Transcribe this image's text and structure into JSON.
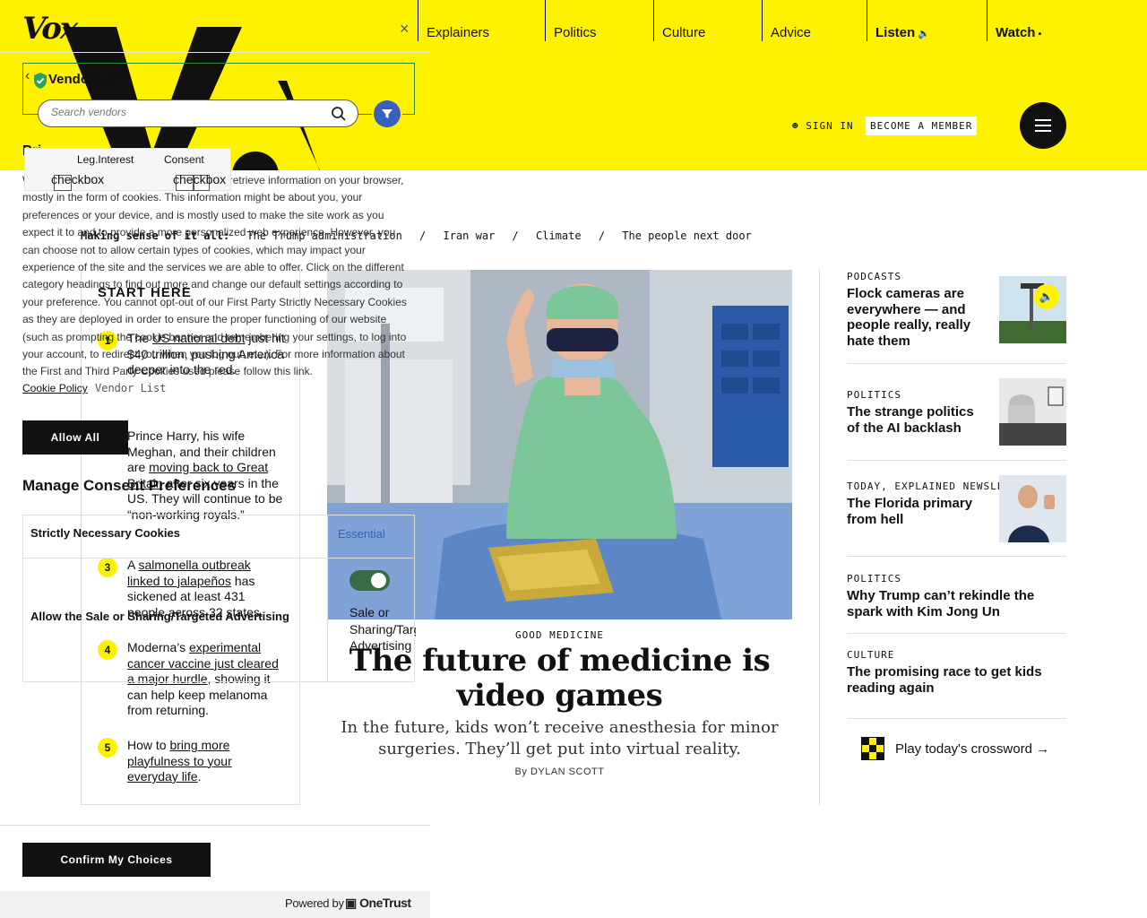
{
  "header": {
    "logo": "Vox",
    "nav": [
      {
        "label": "Explainers",
        "bold": false,
        "glyph": ""
      },
      {
        "label": "Politics",
        "bold": false,
        "glyph": ""
      },
      {
        "label": "Culture",
        "bold": false,
        "glyph": ""
      },
      {
        "label": "Advice",
        "bold": false,
        "glyph": ""
      },
      {
        "label": "Listen",
        "bold": true,
        "glyph": "speaker-icon"
      },
      {
        "label": "Watch",
        "bold": true,
        "glyph": "camera-icon"
      }
    ],
    "sign_in": "SIGN IN",
    "member": "BECOME A MEMBER"
  },
  "breadcrumbs": [
    "Making sense of it all:",
    "The Trump administration",
    "/",
    "Iran war",
    "/",
    "Climate",
    "/",
    "The people next door"
  ],
  "start_here": {
    "title": "START HERE",
    "items": [
      {
        "num": "1",
        "pre": "The ",
        "link": "US national debt",
        "post": " just hit $40 trillion, pushing America deeper into the red."
      },
      {
        "num": "2",
        "pre": "Prince Harry, his wife Meghan, and their children are ",
        "link": "moving back to Great Britain",
        "post": " after six years in the US. They will continue to be “non-working royals.”"
      },
      {
        "num": "3",
        "pre": "A ",
        "link": "salmonella outbreak linked to jalapeños",
        "post": " has sickened at least 431 people across 32 states."
      },
      {
        "num": "4",
        "pre": "Moderna’s ",
        "link": "experimental cancer vaccine just cleared a major hurdle",
        "post": ", showing it can help keep melanoma from returning."
      },
      {
        "num": "5",
        "pre": "How to ",
        "link": "bring more playfulness to your everyday life",
        "post": "."
      }
    ]
  },
  "main_story": {
    "kicker": "GOOD MEDICINE",
    "headline": "The future of medicine is video games",
    "dek": "In the future, kids won’t receive anesthesia for minor surgeries. They’ll get put into virtual reality.",
    "byline": "By DYLAN SCOTT"
  },
  "rail": [
    {
      "kicker": "PODCASTS",
      "title": "Flock cameras are everywhere — and people really, really hate them",
      "audio": true
    },
    {
      "kicker": "POLITICS",
      "title": "The strange politics of the AI backlash",
      "audio": false
    },
    {
      "kicker": "TODAY, EXPLAINED NEWSLETTER",
      "title": "The Florida primary from hell",
      "audio": false
    },
    {
      "kicker": "POLITICS",
      "title": "Why Trump can’t rekindle the spark with Kim Jong Un",
      "audio": false
    },
    {
      "kicker": "CULTURE",
      "title": "The promising race to get kids reading again",
      "audio": false
    }
  ],
  "crossword": "Play today's crossword →",
  "consent": {
    "vendors_title": "Vendors List",
    "close": "×",
    "search_placeholder": "Search vendors",
    "privacy_heading_fragment": "Pri",
    "leg_interest_label": "Leg.Interest",
    "consent_label": "Consent",
    "checkbox_label_1": "checkbox",
    "checkbox_label_2": "checkbox",
    "description": "When you visit any website, it may store or retrieve information on your browser, mostly in the form of cookies. This information might be about you, your preferences or your device, and is mostly used to make the site work as you expect it to and to provide a more personalized web experience. However, you can choose not to allow certain types of cookies, which may impact your experience of the site and the services we are able to offer. Click on the different category headings to find out more and change our default settings according to your preference. You cannot opt-out of our First Party Strictly Necessary Cookies as they are deployed in order to ensure the proper functioning of our website (such as prompting the cookie banner and remembering your settings, to log into your account, to redirect you when you log out, etc.). For more information about the First and Third Party Cookies used please follow this link.",
    "cookie_policy": "Cookie Policy",
    "vendor_list": "Vendor List",
    "allow_all": "Allow All",
    "manage_title": "Manage Consent Preferences",
    "strictly_necessary": "Strictly Necessary Cookies",
    "essential": "Essential",
    "sale_sharing": "Allow the Sale or Sharing/Targeted Advertising",
    "toggle_on": true,
    "toggle_caption": "Sale or Sharing/Targeted Advertising",
    "confirm": "Confirm My Choices",
    "powered_by": "Powered by",
    "onetrust": "OneTrust"
  },
  "colors": {
    "brand_yellow": "#fff200",
    "accent_blue": "#3860be",
    "toggle_green": "#3a6a46"
  }
}
